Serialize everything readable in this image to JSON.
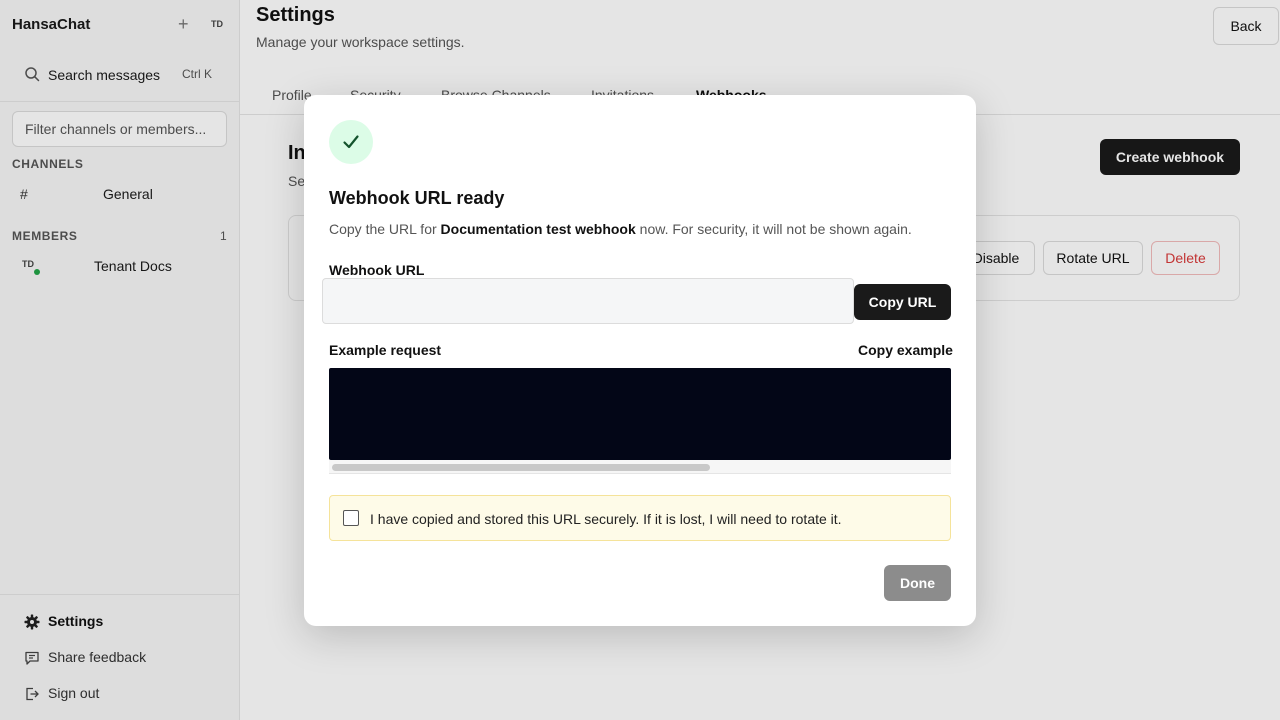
{
  "sidebar": {
    "app_title": "HansaChat",
    "add_icon": "plus-icon",
    "user_initials": "TD",
    "search": {
      "label": "Search messages",
      "shortcut": "Ctrl K",
      "icon": "search-icon"
    },
    "filter": {
      "placeholder": "Filter channels or members..."
    },
    "channels_header": "CHANNELS",
    "channels": [
      {
        "hash": "#",
        "name": "General"
      }
    ],
    "members_header": "MEMBERS",
    "members_count": "1",
    "members": [
      {
        "initials": "TD",
        "name": "Tenant Docs",
        "status": "online"
      }
    ],
    "bottom": [
      {
        "label": "Settings",
        "icon": "gear-icon"
      },
      {
        "label": "Share feedback",
        "icon": "message-icon"
      },
      {
        "label": "Sign out",
        "icon": "sign-out-icon"
      }
    ]
  },
  "main": {
    "title": "Settings",
    "subtitle": "Manage your workspace settings.",
    "back_label": "Back",
    "tabs": [
      {
        "label": "Profile"
      },
      {
        "label": "Security"
      },
      {
        "label": "Browse Channels"
      },
      {
        "label": "Invitations"
      },
      {
        "label": "Webhooks",
        "active": true
      }
    ],
    "section_title": "In",
    "section_desc": "Se",
    "create_label": "Create webhook",
    "card_actions": {
      "disable": "Disable",
      "rotate": "Rotate URL",
      "delete": "Delete"
    }
  },
  "modal": {
    "icon": "check-icon",
    "title": "Webhook URL ready",
    "desc_prefix": "Copy the URL for ",
    "desc_name": "Documentation test webhook",
    "desc_suffix": " now. For security, it will not be shown again.",
    "url_label": "Webhook URL",
    "url_value": "",
    "copy_url_label": "Copy URL",
    "example_label": "Example request",
    "copy_example_label": "Copy example",
    "confirm_text": "I have copied and stored this URL securely. If it is lost, I will need to rotate it.",
    "confirm_checked": false,
    "done_label": "Done"
  },
  "colors": {
    "accent": "#1a1a1a",
    "success_bg": "#dcfce7",
    "success_fg": "#14532d",
    "danger": "#d93a3a",
    "warning_bg": "#fefbe8",
    "code_bg": "#030617"
  }
}
